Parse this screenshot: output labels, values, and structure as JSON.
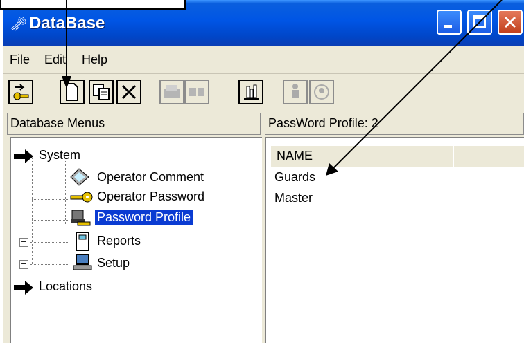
{
  "window": {
    "title": "DataBase"
  },
  "menu": {
    "file": "File",
    "edit": "Edit",
    "help": "Help"
  },
  "panels": {
    "left_header": "Database Menus",
    "right_header": "PassWord Profile:   2"
  },
  "tree": {
    "system": "System",
    "operator_comment": "Operator Comment",
    "operator_password": "Operator Password",
    "password_profile": "Password Profile",
    "reports": "Reports",
    "setup": "Setup",
    "locations": "Locations"
  },
  "list": {
    "column_name": "NAME",
    "rows": [
      "Guards",
      "Master"
    ]
  },
  "colors": {
    "selection": "#0a3bd2",
    "titlebar": "#0055e5"
  }
}
